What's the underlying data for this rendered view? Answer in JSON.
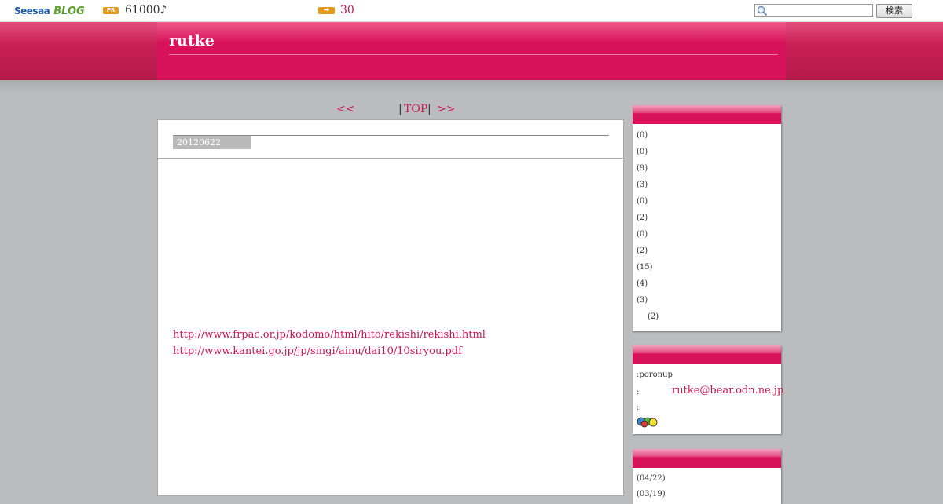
{
  "toolbar": {
    "logo_primary": "Seesaa",
    "logo_secondary": "BLOG",
    "pr_badge": "PR",
    "points": "61000♪",
    "arrow_badge": "➡",
    "days": "30",
    "search_placeholder": "",
    "search_button": "検索"
  },
  "header": {
    "blog_title": "rutke"
  },
  "pager": {
    "prev": "<<",
    "separator_left": "|",
    "top": "TOP",
    "separator_right": "|",
    "next": ">>"
  },
  "article": {
    "date": "20120622",
    "links": [
      "http://www.frpac.or.jp/kodomo/html/hito/rekishi/rekishi.html",
      "http://www.kantei.go.jp/jp/singi/ainu/dai10/10siryou.pdf"
    ]
  },
  "sidebar": {
    "categories": [
      {
        "count": "(0)"
      },
      {
        "count": "(0)"
      },
      {
        "count": "(9)"
      },
      {
        "count": "(3)"
      },
      {
        "count": "(0)"
      },
      {
        "count": "(2)"
      },
      {
        "count": "(0)"
      },
      {
        "count": "(2)"
      },
      {
        "count": "(15)"
      },
      {
        "count": "(4)"
      },
      {
        "count": "(3)"
      },
      {
        "count": "(2)"
      }
    ],
    "profile": {
      "name": ":poronup",
      "colon_1": ":",
      "email": "rutke@bear.odn.ne.jp",
      "colon_2": ":",
      "icon": "smiley-faces-icon"
    },
    "archive": {
      "item_1": "(04/22)",
      "item_2": "(03/19)"
    }
  },
  "colors": {
    "accent": "#d8125a",
    "link": "#c8174f",
    "background": "#bbbcbe"
  }
}
